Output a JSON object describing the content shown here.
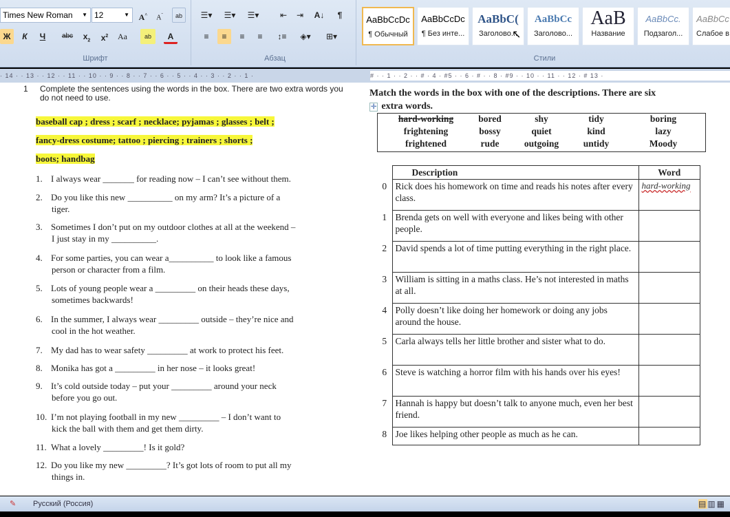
{
  "ribbon": {
    "font_name": "Times New Roman",
    "font_size": "12",
    "font_group": "Шрифт",
    "para_group": "Абзац",
    "styles_group": "Стили",
    "styles": [
      {
        "preview": "AaBbCcDc",
        "name": "¶ Обычный"
      },
      {
        "preview": "AaBbCcDc",
        "name": "¶ Без инте..."
      },
      {
        "preview": "AaBbC(",
        "name": "Заголово..."
      },
      {
        "preview": "AaBbCc",
        "name": "Заголово..."
      },
      {
        "preview": "AaB",
        "name": "Название"
      },
      {
        "preview": "AaBbCc.",
        "name": "Подзагол..."
      },
      {
        "preview": "AaBbCc",
        "name": "Слабое в"
      }
    ]
  },
  "ruler": {
    "left": "· 14 · · 13 · · 12 · · 11 · · 10 · · 9 · · 8 · · 7 · · 6 · · 5 · · 4 · · 3 · · 2 · · 1 ·",
    "right": "# · · 1 · · 2 · · # · 4 · #5 · · 6 · # · · 8 · #9 · · 10 · · 11 · · 12 · # 13 ·"
  },
  "left": {
    "num": "1",
    "instruction": "Complete the sentences using the words in the box. There are two extra words you do not need to use.",
    "box": [
      "baseball cap ; dress ; scarf ; necklace; pyjamas ;   glasses  ; belt ;",
      "fancy-dress costume; tattoo  ; piercing  ;    trainers  ;   shorts ;",
      "boots; handbag"
    ],
    "questions": [
      {
        "n": "1.",
        "t": "I always wear _______ for reading now – I can’t see without them.",
        "t2": ""
      },
      {
        "n": "2.",
        "t": "Do you like this new __________ on my arm? It’s a picture of a",
        "t2": "tiger."
      },
      {
        "n": "3.",
        "t": "Sometimes I don’t put on my outdoor clothes at all at the weekend –",
        "t2": "I just stay in my __________."
      },
      {
        "n": "4.",
        "t": "For some parties, you can wear a__________ to look like a famous",
        "t2": "person or character from a film."
      },
      {
        "n": "5.",
        "t": "Lots of young people wear a _________ on their heads these days,",
        "t2": "sometimes backwards!"
      },
      {
        "n": "6.",
        "t": "In the summer, I always wear _________ outside – they’re nice and",
        "t2": "cool in the hot weather."
      },
      {
        "n": "7.",
        "t": "My dad has to wear safety _________ at work to protect his feet.",
        "t2": ""
      },
      {
        "n": "8.",
        "t": "Monika has got a _________ in her nose – it looks great!",
        "t2": ""
      },
      {
        "n": "9.",
        "t": "It’s cold outside today – put your _________ around your neck",
        "t2": "before you go out."
      },
      {
        "n": "10.",
        "t": "I’m not playing football in my new _________ – I don’t want to",
        "t2": "kick the ball with them and get them dirty."
      },
      {
        "n": "11.",
        "t": "What a lovely _________! Is it gold?",
        "t2": ""
      },
      {
        "n": "12.",
        "t": "Do you like my new _________? It’s got lots of room to put all my",
        "t2": "things in."
      }
    ]
  },
  "right": {
    "instruction": "Match the words in the box with one of the descriptions.  There are six",
    "instruction2": "extra words.",
    "words": [
      "hard-working",
      "bored",
      "shy",
      "tidy",
      "boring",
      "frightening",
      "bossy",
      "quiet",
      "kind",
      "lazy",
      "frightened",
      "rude",
      "outgoing",
      "untidy",
      "Moody"
    ],
    "table": {
      "h1": "Description",
      "h2": "Word",
      "rows": [
        {
          "n": "0",
          "d": "Rick does his homework on time and reads his notes after every class.",
          "w": "hard-working"
        },
        {
          "n": "1",
          "d": "Brenda gets on well with everyone and likes being with other people.",
          "w": ""
        },
        {
          "n": "2",
          "d": "David spends a lot of time putting everything in the right place.",
          "w": ""
        },
        {
          "n": "3",
          "d": "William is sitting in a maths class. He’s not interested in maths at all.",
          "w": ""
        },
        {
          "n": "4",
          "d": "Polly doesn’t like doing her homework or doing any jobs around the house.",
          "w": ""
        },
        {
          "n": "5",
          "d": "Carla always tells her little brother and sister what to do.",
          "w": ""
        },
        {
          "n": "6",
          "d": "Steve is watching a horror film with his hands over his eyes!",
          "w": ""
        },
        {
          "n": "7",
          "d": "Hannah is happy but doesn’t talk to anyone much, even her best friend.",
          "w": ""
        },
        {
          "n": "8",
          "d": "Joe likes helping other people as much as he can.",
          "w": ""
        }
      ]
    }
  },
  "status": {
    "language": "Русский (Россия)"
  }
}
